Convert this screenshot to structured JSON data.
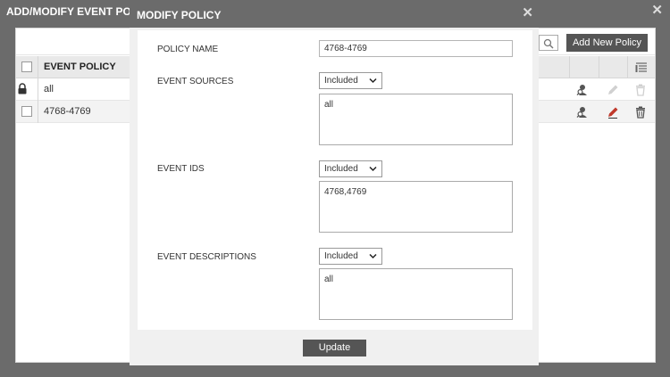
{
  "background_dialog": {
    "title": "ADD/MODIFY EVENT POLICY",
    "close_glyph": "✕",
    "add_button_label": "Add New Policy",
    "table": {
      "header": "EVENT POLICY",
      "rows": [
        {
          "label": "all",
          "locked": true
        },
        {
          "label": "4768-4769",
          "locked": false
        }
      ]
    }
  },
  "modal": {
    "title": "MODIFY POLICY",
    "close_glyph": "✕",
    "policy_name_label": "POLICY NAME",
    "policy_name_value": "4768-4769",
    "event_sources": {
      "label": "EVENT SOURCES",
      "mode": "Included",
      "value": "all"
    },
    "event_ids": {
      "label": "EVENT IDS",
      "mode": "Included",
      "value": "4768,4769"
    },
    "event_descriptions": {
      "label": "EVENT DESCRIPTIONS",
      "mode": "Included",
      "value": "all"
    },
    "update_label": "Update"
  },
  "colors": {
    "overlay": "#6b6b6b",
    "button": "#555555",
    "edit_icon_active": "#c0392b",
    "icon_disabled": "#cfcfcf"
  },
  "icons": {
    "search": "search-icon",
    "lock": "lock-icon",
    "assign": "user-search-icon",
    "edit": "pencil-icon",
    "delete": "trash-icon",
    "column_settings": "column-settings-icon",
    "dropdown": "chevron-down-icon"
  }
}
